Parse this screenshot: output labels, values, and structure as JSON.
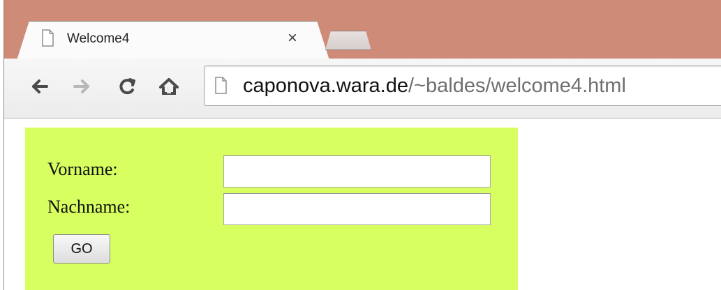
{
  "browser": {
    "tab": {
      "title": "Welcome4",
      "close_label": "×"
    },
    "address": {
      "host": "caponova.wara.de",
      "path": "/~baldes/welcome4.html"
    },
    "titlebar_color": "#cd8b78",
    "icons": [
      "back-arrow-icon",
      "forward-arrow-icon",
      "reload-icon",
      "home-icon",
      "page-icon",
      "close-icon"
    ]
  },
  "form": {
    "background": "#d7ff5f",
    "vorname_label": "Vorname:",
    "nachname_label": "Nachname:",
    "vorname_value": "",
    "nachname_value": "",
    "go_label": "GO"
  }
}
